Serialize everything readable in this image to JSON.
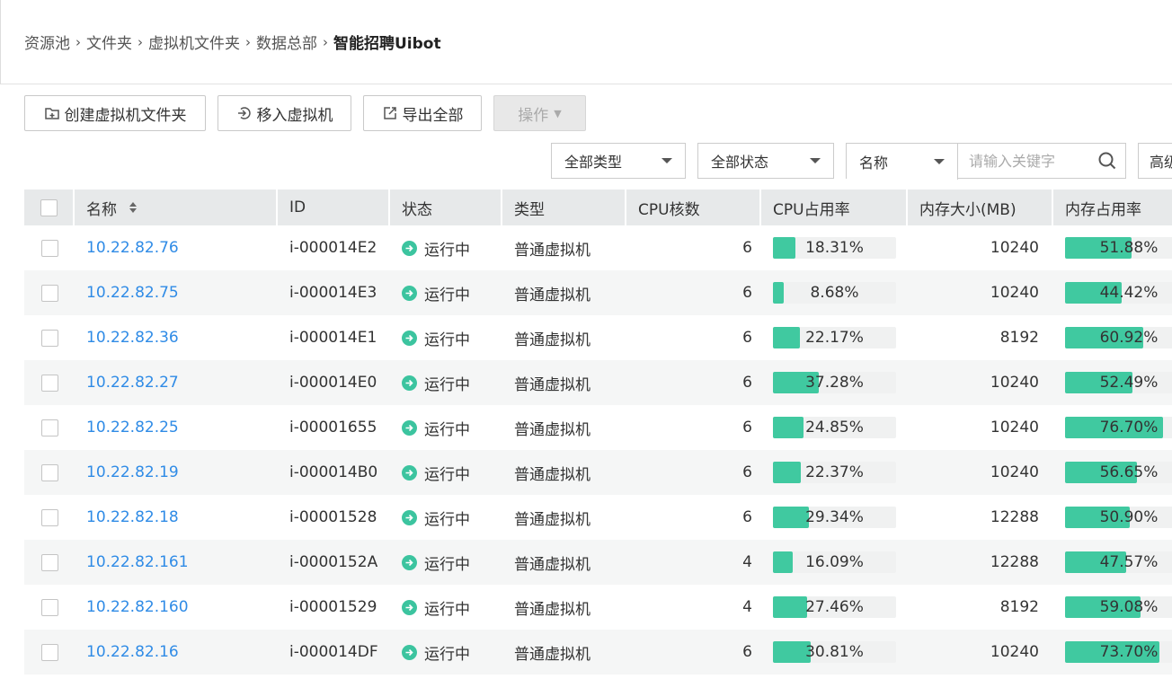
{
  "breadcrumb": {
    "items": [
      "资源池",
      "文件夹",
      "虚拟机文件夹",
      "数据总部"
    ],
    "current": "智能招聘Uibot"
  },
  "toolbar": {
    "create_folder": "创建虚拟机文件夹",
    "move_in": "移入虚拟机",
    "export_all": "导出全部",
    "operations": "操作"
  },
  "filters": {
    "type": "全部类型",
    "status": "全部状态",
    "field": "名称",
    "search_placeholder": "请输入关键字",
    "advanced": "高级"
  },
  "table": {
    "headers": {
      "name": "名称",
      "id": "ID",
      "status": "状态",
      "type": "类型",
      "cpu": "CPU核数",
      "cpu_usage": "CPU占用率",
      "memory": "内存大小(MB)",
      "memory_usage": "内存占用率"
    },
    "rows": [
      {
        "name": "10.22.82.76",
        "id": "i-000014E2",
        "status": "运行中",
        "type": "普通虚拟机",
        "cpu": "6",
        "cpu_usage": "18.31%",
        "cpu_usage_value": 18.31,
        "memory": "10240",
        "memory_usage": "51.88%",
        "memory_usage_value": 51.88
      },
      {
        "name": "10.22.82.75",
        "id": "i-000014E3",
        "status": "运行中",
        "type": "普通虚拟机",
        "cpu": "6",
        "cpu_usage": "8.68%",
        "cpu_usage_value": 8.68,
        "memory": "10240",
        "memory_usage": "44.42%",
        "memory_usage_value": 44.42
      },
      {
        "name": "10.22.82.36",
        "id": "i-000014E1",
        "status": "运行中",
        "type": "普通虚拟机",
        "cpu": "6",
        "cpu_usage": "22.17%",
        "cpu_usage_value": 22.17,
        "memory": "8192",
        "memory_usage": "60.92%",
        "memory_usage_value": 60.92
      },
      {
        "name": "10.22.82.27",
        "id": "i-000014E0",
        "status": "运行中",
        "type": "普通虚拟机",
        "cpu": "6",
        "cpu_usage": "37.28%",
        "cpu_usage_value": 37.28,
        "memory": "10240",
        "memory_usage": "52.49%",
        "memory_usage_value": 52.49
      },
      {
        "name": "10.22.82.25",
        "id": "i-00001655",
        "status": "运行中",
        "type": "普通虚拟机",
        "cpu": "6",
        "cpu_usage": "24.85%",
        "cpu_usage_value": 24.85,
        "memory": "10240",
        "memory_usage": "76.70%",
        "memory_usage_value": 76.7
      },
      {
        "name": "10.22.82.19",
        "id": "i-000014B0",
        "status": "运行中",
        "type": "普通虚拟机",
        "cpu": "6",
        "cpu_usage": "22.37%",
        "cpu_usage_value": 22.37,
        "memory": "10240",
        "memory_usage": "56.65%",
        "memory_usage_value": 56.65
      },
      {
        "name": "10.22.82.18",
        "id": "i-00001528",
        "status": "运行中",
        "type": "普通虚拟机",
        "cpu": "6",
        "cpu_usage": "29.34%",
        "cpu_usage_value": 29.34,
        "memory": "12288",
        "memory_usage": "50.90%",
        "memory_usage_value": 50.9
      },
      {
        "name": "10.22.82.161",
        "id": "i-0000152A",
        "status": "运行中",
        "type": "普通虚拟机",
        "cpu": "4",
        "cpu_usage": "16.09%",
        "cpu_usage_value": 16.09,
        "memory": "12288",
        "memory_usage": "47.57%",
        "memory_usage_value": 47.57
      },
      {
        "name": "10.22.82.160",
        "id": "i-00001529",
        "status": "运行中",
        "type": "普通虚拟机",
        "cpu": "4",
        "cpu_usage": "27.46%",
        "cpu_usage_value": 27.46,
        "memory": "8192",
        "memory_usage": "59.08%",
        "memory_usage_value": 59.08
      },
      {
        "name": "10.22.82.16",
        "id": "i-000014DF",
        "status": "运行中",
        "type": "普通虚拟机",
        "cpu": "6",
        "cpu_usage": "30.81%",
        "cpu_usage_value": 30.81,
        "memory": "10240",
        "memory_usage": "73.70%",
        "memory_usage_value": 73.7
      }
    ]
  },
  "colors": {
    "link": "#2f8be6",
    "status_running": "#3cc49f",
    "bar_fill": "#40c9a0",
    "header_bg": "#e7e9ea"
  },
  "icons": {
    "create_folder": "folder-add-icon",
    "move_in": "move-in-icon",
    "export": "export-icon",
    "search": "search-icon",
    "status": "running-arrow-icon",
    "sort": "sort-icon"
  }
}
